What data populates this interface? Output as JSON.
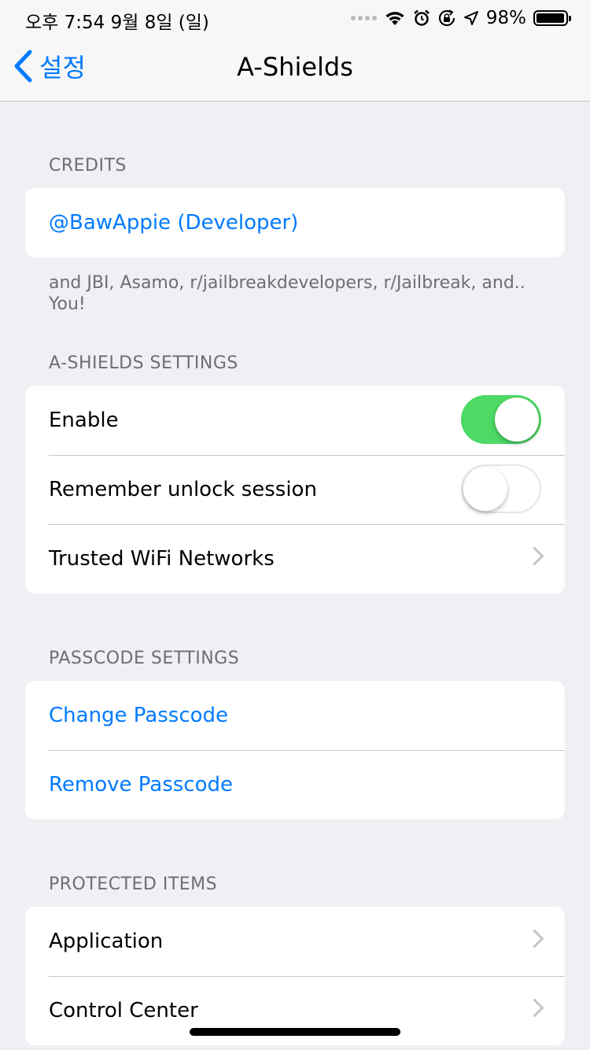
{
  "status_bar": {
    "time": "오후 7:54   9월 8일 (일)",
    "battery_percent": "98%",
    "battery_level": 0.98,
    "icons": [
      "signal-dots-icon",
      "wifi-icon",
      "alarm-icon",
      "orientation-lock-icon",
      "location-icon",
      "battery-icon"
    ]
  },
  "nav": {
    "back_label": "설정",
    "title": "A-Shields"
  },
  "credits": {
    "header": "CREDITS",
    "developer_link": "@BawAppie (Developer)",
    "footer": "and JBI, Asamo, r/jailbreakdevelopers, r/Jailbreak, and.. You!"
  },
  "settings": {
    "header": "A-SHIELDS SETTINGS",
    "enable_label": "Enable",
    "enable_on": true,
    "remember_label": "Remember unlock session",
    "remember_on": false,
    "wifi_label": "Trusted WiFi Networks"
  },
  "passcode": {
    "header": "PASSCODE SETTINGS",
    "change_label": "Change Passcode",
    "remove_label": "Remove Passcode"
  },
  "protected": {
    "header": "PROTECTED ITEMS",
    "application_label": "Application",
    "control_center_label": "Control Center"
  },
  "colors": {
    "accent": "#007aff",
    "toggle_on": "#4cd964",
    "background": "#efeff4"
  }
}
